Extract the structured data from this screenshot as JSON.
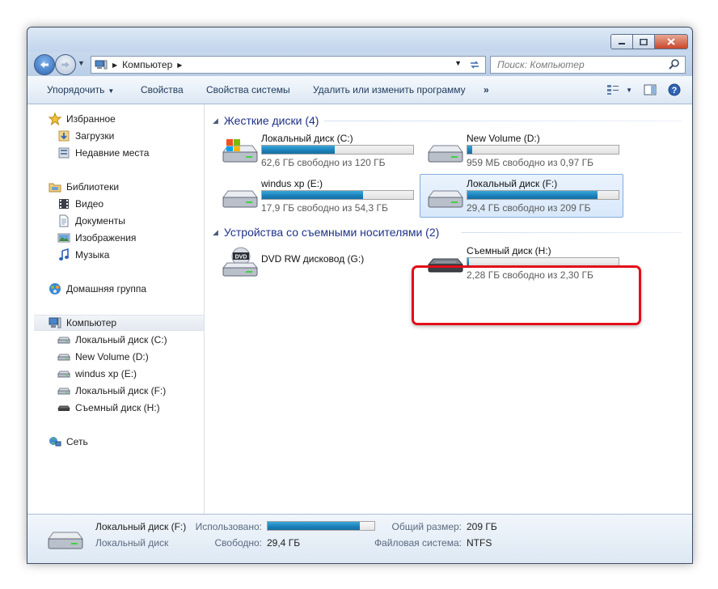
{
  "window": {
    "address": {
      "crumb": "Компьютер"
    },
    "search": {
      "placeholder": "Поиск: Компьютер"
    }
  },
  "toolbar": {
    "organize": "Упорядочить",
    "properties": "Свойства",
    "system_properties": "Свойства системы",
    "uninstall": "Удалить или изменить программу",
    "more": "»"
  },
  "nav": {
    "favorites": {
      "label": "Избранное",
      "items": [
        "Загрузки",
        "Недавние места"
      ]
    },
    "libraries": {
      "label": "Библиотеки",
      "items": [
        "Видео",
        "Документы",
        "Изображения",
        "Музыка"
      ]
    },
    "homegroup": "Домашняя группа",
    "computer": {
      "label": "Компьютер",
      "items": [
        "Локальный диск (C:)",
        "New Volume (D:)",
        "windus xp (E:)",
        "Локальный диск (F:)",
        "Съемный диск (H:)"
      ]
    },
    "network": "Сеть"
  },
  "groups": {
    "hard_disks": "Жесткие диски (4)",
    "removable": "Устройства со съемными носителями (2)"
  },
  "drives": [
    {
      "name": "Локальный диск (C:)",
      "free_text": "62,6 ГБ свободно из 120 ГБ",
      "used_fraction": 0.48
    },
    {
      "name": "New Volume (D:)",
      "free_text": "959 МБ свободно из 0,97 ГБ",
      "used_fraction": 0.03
    },
    {
      "name": "windus xp (E:)",
      "free_text": "17,9 ГБ свободно из 54,3 ГБ",
      "used_fraction": 0.67
    },
    {
      "name": "Локальный диск (F:)",
      "free_text": "29,4 ГБ свободно из 209 ГБ",
      "used_fraction": 0.86
    }
  ],
  "removable_devices": [
    {
      "name": "DVD RW дисковод (G:)"
    },
    {
      "name": "Съемный диск (H:)",
      "free_text": "2,28 ГБ свободно из 2,30 ГБ",
      "used_fraction": 0.01
    }
  ],
  "details": {
    "name": "Локальный диск (F:)",
    "type": "Локальный диск",
    "used_label": "Использовано:",
    "used_fraction": 0.86,
    "free_label": "Свободно:",
    "free_value": "29,4 ГБ",
    "total_label": "Общий размер:",
    "total_value": "209 ГБ",
    "fs_label": "Файловая система:",
    "fs_value": "NTFS"
  },
  "colors": {
    "accent": "#1e3287",
    "highlight": "#e30e1a",
    "bar_fill": "#1b7fb9"
  }
}
